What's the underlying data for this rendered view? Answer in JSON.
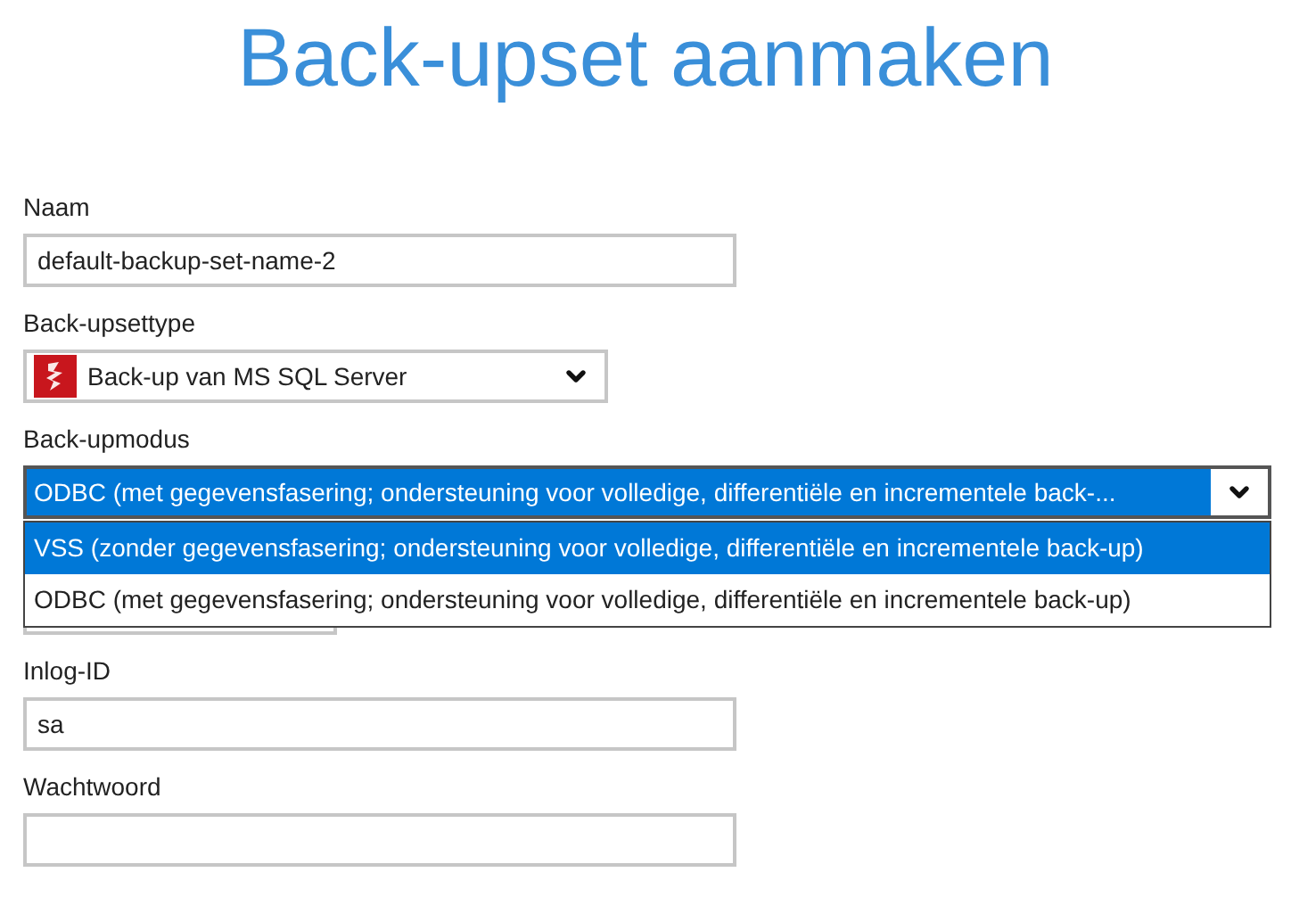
{
  "title": "Back-upset aanmaken",
  "fields": [
    {
      "kind": "text",
      "label": "Naam",
      "value": "default-backup-set-name-2"
    },
    {
      "kind": "icon-select",
      "label": "Back-upsettype",
      "value": "Back-up van MS SQL Server",
      "open": false
    },
    {
      "kind": "select",
      "label": "Back-upmodus",
      "value": "ODBC (met gegevensfasering; ondersteuning voor volledige, differentiële en incrementele back-...",
      "open": true,
      "options": [
        {
          "label": "VSS (zonder gegevensfasering; ondersteuning voor volledige, differentiële en incrementele back-up)",
          "selected": true
        },
        {
          "label": "ODBC (met gegevensfasering; ondersteuning voor volledige, differentiële en incrementele back-up)",
          "selected": false
        }
      ]
    },
    {
      "kind": "short"
    },
    {
      "kind": "text",
      "label": "Inlog-ID",
      "value": "sa"
    },
    {
      "kind": "password",
      "label": "Wachtwoord"
    }
  ]
}
